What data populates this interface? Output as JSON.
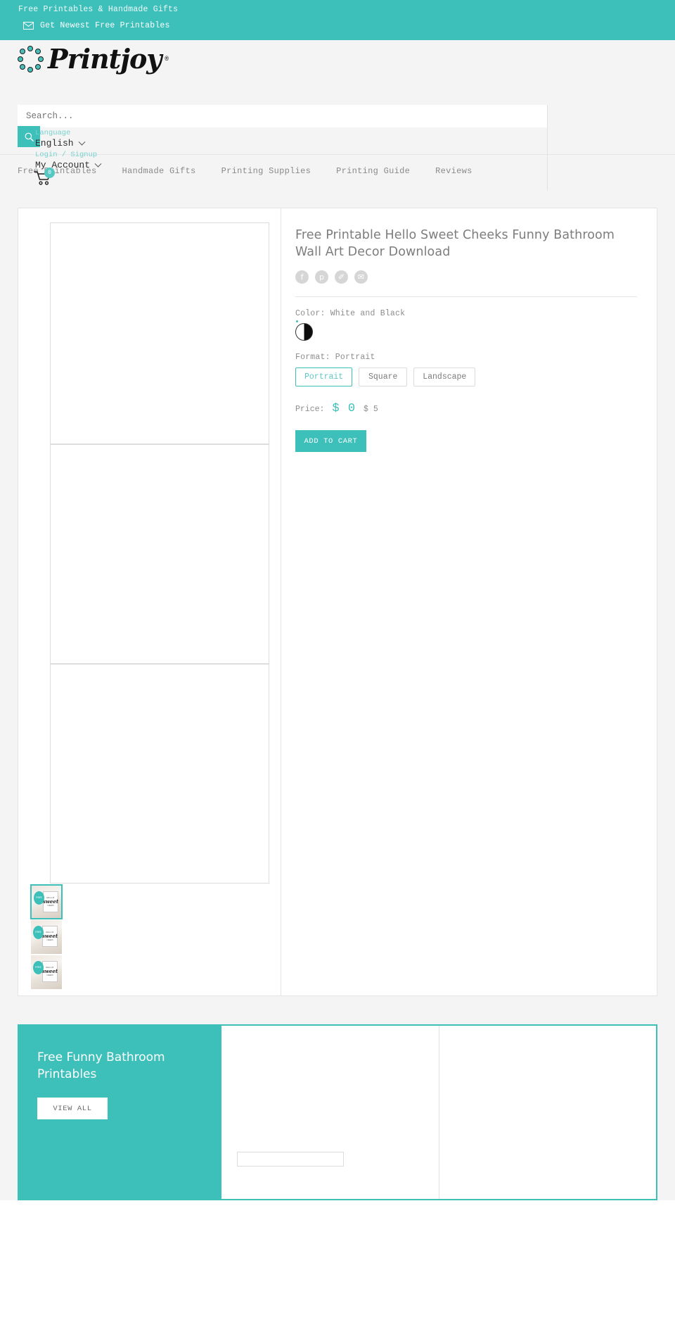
{
  "announcement": {
    "tagline": "Free Printables & Handmade Gifts",
    "newsletter_label": "Get Newest Free Printables",
    "mail_icon": "mail-icon",
    "bg_color": "#3dbfba"
  },
  "header": {
    "logo_text": "Printjoy",
    "logo_registered": "®",
    "search": {
      "placeholder": "Search...",
      "value": "",
      "icon": "search-icon"
    },
    "language": {
      "label": "Language",
      "value": "English",
      "chevron": "chevron-down-icon"
    },
    "account": {
      "login_label": "Login / Signup",
      "value": "My Account",
      "chevron": "chevron-down-icon"
    },
    "cart": {
      "icon": "shopping-cart-icon",
      "count": "0",
      "badge_color": "#56c8c3"
    }
  },
  "nav": {
    "items": [
      {
        "label": "Free Printables"
      },
      {
        "label": "Handmade Gifts"
      },
      {
        "label": "Printing Supplies"
      },
      {
        "label": "Printing Guide"
      },
      {
        "label": "Reviews"
      }
    ]
  },
  "product": {
    "title": "Free Printable Hello Sweet Cheeks Funny Bathroom Wall Art Decor Download",
    "share": [
      {
        "name": "facebook-icon",
        "glyph": "f"
      },
      {
        "name": "pinterest-icon",
        "glyph": "p"
      },
      {
        "name": "twitter-icon",
        "glyph": "✐"
      },
      {
        "name": "email-icon",
        "glyph": "✉"
      }
    ],
    "color": {
      "label": "Color: White and Black",
      "selected": "White and Black"
    },
    "format": {
      "label": "Format: Portrait",
      "selected": "Portrait",
      "options": [
        "Portrait",
        "Square",
        "Landscape"
      ]
    },
    "price": {
      "label": "Price:",
      "current": "$ 0",
      "original": "$ 5",
      "accent_color": "#3dbfba"
    },
    "add_to_cart_label": "ADD TO CART",
    "gallery": {
      "images": [
        {
          "alt": "product-image-1"
        },
        {
          "alt": "product-image-2"
        },
        {
          "alt": "product-image-3"
        }
      ],
      "thumbnails": [
        {
          "alt": "thumbnail-1",
          "badge": "FREE",
          "line1": "HELLO",
          "line2": "sweet",
          "line3": "CHEEKS",
          "active": true
        },
        {
          "alt": "thumbnail-2",
          "badge": "FREE",
          "line1": "HELLO",
          "line2": "sweet",
          "line3": "CHEEKS",
          "active": false
        },
        {
          "alt": "thumbnail-3",
          "badge": "FREE",
          "line1": "HELLO",
          "line2": "sweet",
          "line3": "CHEEKS",
          "active": false
        }
      ]
    }
  },
  "promo": {
    "title": "Free Funny Bathroom Printables",
    "button_label": "VIEW ALL",
    "bg_color": "#3dbfba"
  }
}
